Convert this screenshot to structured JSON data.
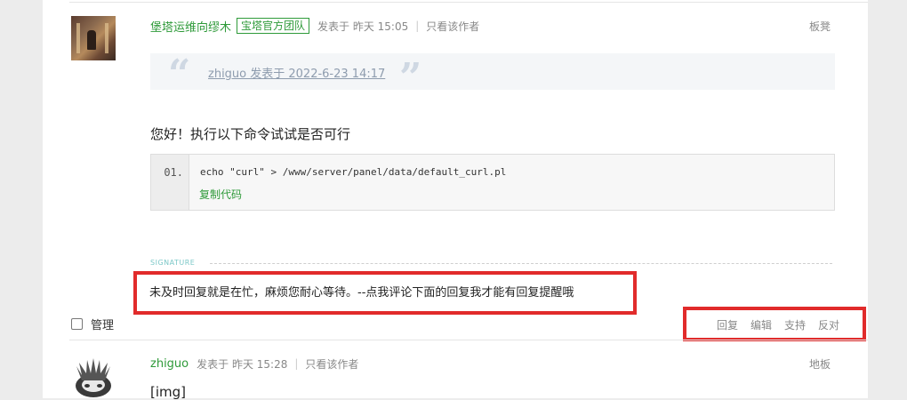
{
  "post1": {
    "author": "堡塔运维向缪木",
    "badge": "宝塔官方团队",
    "posted": "发表于 昨天 15:05",
    "separator": "|",
    "only_author": "只看该作者",
    "floor": "板凳",
    "quote": {
      "open": "“",
      "close": "”",
      "text": "zhiguo 发表于 2022-6-23 14:17"
    },
    "body": "您好！执行以下命令试试是否可行",
    "code": {
      "line_number": "01.",
      "text": "echo \"curl\" > /www/server/panel/data/default_curl.pl",
      "copy_label": "复制代码"
    },
    "signature": {
      "label": "SIGNATURE",
      "text": "未及时回复就是在忙，麻烦您耐心等待。--点我评论下面的回复我才能有回复提醒哦"
    }
  },
  "toolbar": {
    "manage_label": "管理",
    "actions": {
      "reply": "回复",
      "edit": "编辑",
      "support": "支持",
      "oppose": "反对"
    }
  },
  "post2": {
    "author": "zhiguo",
    "posted": "发表于 昨天 15:28",
    "separator": "|",
    "only_author": "只看该作者",
    "floor": "地板",
    "body": "[img]"
  },
  "colors": {
    "accent_green": "#2e9a39",
    "highlight_red": "#e12b2b"
  },
  "icons": {
    "checkbox": "checkbox-icon",
    "quote": "quote-mark-icon"
  }
}
